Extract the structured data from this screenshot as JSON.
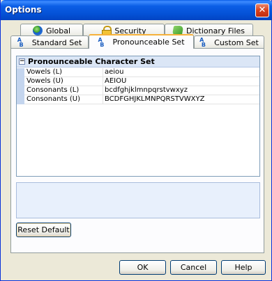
{
  "window": {
    "title": "Options",
    "close_glyph": "✕"
  },
  "tabs_back": [
    {
      "label": "Global",
      "icon": "globe-icon"
    },
    {
      "label": "Security",
      "icon": "lock-icon"
    },
    {
      "label": "Dictionary Files",
      "icon": "dictionary-icon"
    }
  ],
  "tabs_front": [
    {
      "label": "Standard Set",
      "icon": "ab-charset-icon"
    },
    {
      "label": "Pronounceable Set",
      "icon": "ab-charset-icon",
      "active": true
    },
    {
      "label": "Custom Set",
      "icon": "ab-charset-icon"
    }
  ],
  "property_grid": {
    "category": "Pronounceable Character Set",
    "expander": "−",
    "rows": [
      {
        "name": "Vowels (L)",
        "value": "aeiou"
      },
      {
        "name": "Vowels (U)",
        "value": "AEIOU"
      },
      {
        "name": "Consonants (L)",
        "value": "bcdfghjklmnpqrstvwxyz"
      },
      {
        "name": "Consonants (U)",
        "value": "BCDFGHJKLMNPQRSTVWXYZ"
      }
    ]
  },
  "buttons": {
    "reset": "Reset Default",
    "ok": "OK",
    "cancel": "Cancel",
    "help": "Help"
  },
  "colors": {
    "titlebar": "#0451d6",
    "active_tab_accent": "#f6b13a",
    "grid_header": "#dbe6f6",
    "description_pane": "#e8f0fc"
  }
}
